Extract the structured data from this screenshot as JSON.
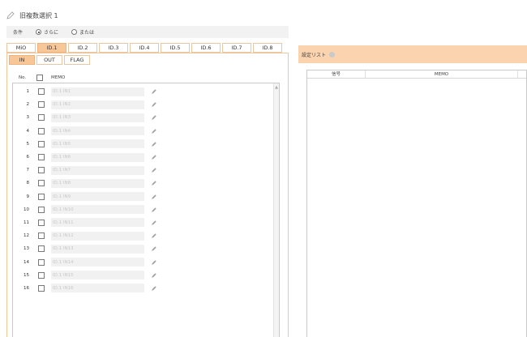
{
  "header": {
    "title": "旧複数選択 1",
    "icon": "pencil-icon"
  },
  "condition": {
    "label": "条件",
    "options": [
      {
        "label": "さらに",
        "selected": true
      },
      {
        "label": "または",
        "selected": false
      }
    ]
  },
  "id_tabs": [
    {
      "label": "MiO",
      "active": false
    },
    {
      "label": "ID.1",
      "active": true
    },
    {
      "label": "ID.2",
      "active": false
    },
    {
      "label": "ID.3",
      "active": false
    },
    {
      "label": "ID.4",
      "active": false
    },
    {
      "label": "ID.5",
      "active": false
    },
    {
      "label": "ID.6",
      "active": false
    },
    {
      "label": "ID.7",
      "active": false
    },
    {
      "label": "ID.8",
      "active": false
    }
  ],
  "io_tabs": [
    {
      "label": "IN",
      "active": true
    },
    {
      "label": "OUT",
      "active": false
    },
    {
      "label": "FLAG",
      "active": false
    }
  ],
  "list": {
    "col_no": "No.",
    "col_memo": "MEMO",
    "rows": [
      {
        "no": "1",
        "placeholder": "ID.1 IN1"
      },
      {
        "no": "2",
        "placeholder": "ID.1 IN2"
      },
      {
        "no": "3",
        "placeholder": "ID.1 IN3"
      },
      {
        "no": "4",
        "placeholder": "ID.1 IN4"
      },
      {
        "no": "5",
        "placeholder": "ID.1 IN5"
      },
      {
        "no": "6",
        "placeholder": "ID.1 IN6"
      },
      {
        "no": "7",
        "placeholder": "ID.1 IN7"
      },
      {
        "no": "8",
        "placeholder": "ID.1 IN8"
      },
      {
        "no": "9",
        "placeholder": "ID.1 IN9"
      },
      {
        "no": "10",
        "placeholder": "ID.1 IN10"
      },
      {
        "no": "11",
        "placeholder": "ID.1 IN11"
      },
      {
        "no": "12",
        "placeholder": "ID.1 IN12"
      },
      {
        "no": "13",
        "placeholder": "ID.1 IN13"
      },
      {
        "no": "14",
        "placeholder": "ID.1 IN14"
      },
      {
        "no": "15",
        "placeholder": "ID.1 IN15"
      },
      {
        "no": "16",
        "placeholder": "ID.1 IN16"
      }
    ]
  },
  "settings_list": {
    "title": "設定リスト",
    "info_icon": "info-icon",
    "columns": [
      "信号",
      "MEMO"
    ]
  },
  "colors": {
    "accent_tab": "#f8c797",
    "accent_header": "#fbd3ae",
    "border_orange": "#f0c69a"
  }
}
